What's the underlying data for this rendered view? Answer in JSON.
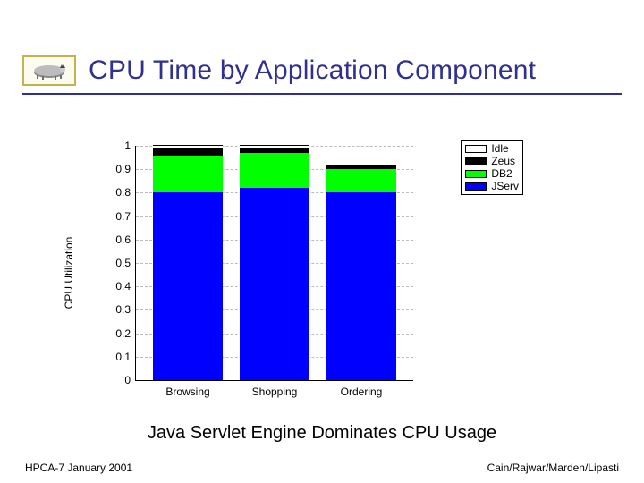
{
  "header": {
    "title": "CPU Time by Application Component",
    "logo_alt": "badger-logo"
  },
  "chart_data": {
    "type": "bar",
    "stacked": true,
    "categories": [
      "Browsing",
      "Shopping",
      "Ordering"
    ],
    "series": [
      {
        "name": "JServ",
        "values": [
          0.8,
          0.82,
          0.8
        ],
        "color": "#0000ff"
      },
      {
        "name": "DB2",
        "values": [
          0.16,
          0.15,
          0.1
        ],
        "color": "#00ff00"
      },
      {
        "name": "Zeus",
        "values": [
          0.03,
          0.02,
          0.02
        ],
        "color": "#000000"
      },
      {
        "name": "Idle",
        "values": [
          0.01,
          0.01,
          0.0
        ],
        "color": "#ffffff"
      }
    ],
    "legend_order": [
      "Idle",
      "Zeus",
      "DB2",
      "JServ"
    ],
    "ylabel": "CPU Utilization",
    "ylim": [
      0,
      1
    ],
    "yticks": [
      0,
      0.1,
      0.2,
      0.3,
      0.4,
      0.5,
      0.6,
      0.7,
      0.8,
      0.9,
      1
    ],
    "ytick_labels": [
      "0",
      "0.1",
      "0.2",
      "0.3",
      "0.4",
      "0.5",
      "0.6",
      "0.7",
      "0.8",
      "0.9",
      "1"
    ],
    "title": "",
    "xlabel": ""
  },
  "caption": "Java Servlet Engine Dominates CPU Usage",
  "footer": {
    "left": "HPCA-7  January 2001",
    "right": "Cain/Rajwar/Marden/Lipasti"
  },
  "legend": {
    "items": [
      {
        "key": "idle",
        "label": "Idle"
      },
      {
        "key": "zeus",
        "label": "Zeus"
      },
      {
        "key": "db2",
        "label": "DB2"
      },
      {
        "key": "jserv",
        "label": "JServ"
      }
    ]
  }
}
